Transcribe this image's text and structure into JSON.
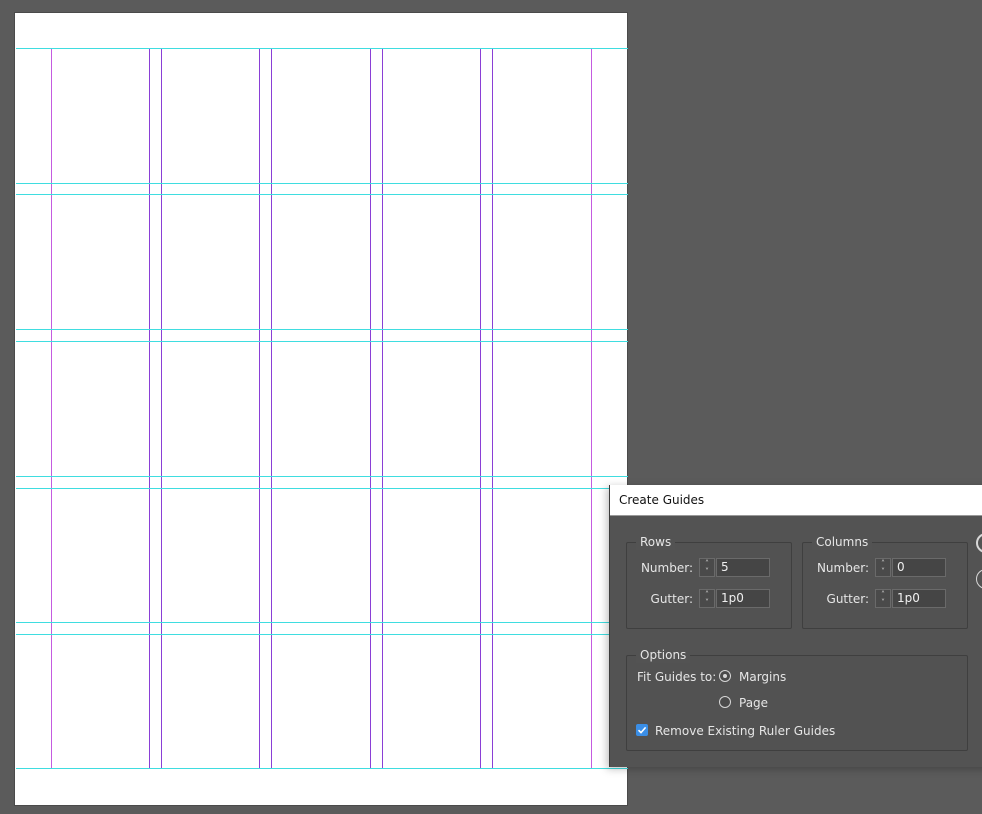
{
  "dialog": {
    "title": "Create Guides",
    "rows": {
      "legend": "Rows",
      "number_label": "Number:",
      "number_value": "5",
      "gutter_label": "Gutter:",
      "gutter_value": "1p0"
    },
    "columns": {
      "legend": "Columns",
      "number_label": "Number:",
      "number_value": "0",
      "gutter_label": "Gutter:",
      "gutter_value": "1p0"
    },
    "options": {
      "legend": "Options",
      "fit_label": "Fit Guides to:",
      "fit_choices": [
        "Margins",
        "Page"
      ],
      "fit_selected": "Margins",
      "remove_existing_label": "Remove Existing Ruler Guides",
      "remove_existing_checked": true
    }
  },
  "colors": {
    "canvas": "#5b5b5b",
    "page": "#ffffff",
    "ruler_guide": "#3fdde0",
    "column_guide": "#8a3fd6",
    "margin_guide": "#c45be0",
    "checkbox_accent": "#3a8ee6"
  }
}
